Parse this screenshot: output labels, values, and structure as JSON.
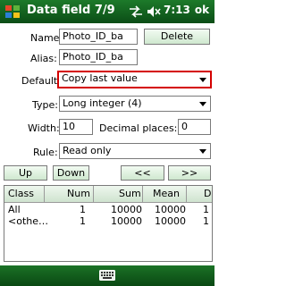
{
  "titlebar": {
    "title": "Data field 7/9",
    "time": "7:13",
    "ok_label": "ok"
  },
  "form": {
    "name_label": "Name:",
    "name_value": "Photo_ID_ba",
    "delete_label": "Delete",
    "alias_label": "Alias:",
    "alias_value": "Photo_ID_ba",
    "default_label": "Default:",
    "default_value": "Copy last value",
    "type_label": "Type:",
    "type_value": "Long integer (4)",
    "width_label": "Width:",
    "width_value": "10",
    "decimal_label": "Decimal places:",
    "decimal_value": "0",
    "rule_label": "Rule:",
    "rule_value": "Read only"
  },
  "nav": {
    "up_label": "Up",
    "down_label": "Down",
    "prev_label": "<<",
    "next_label": ">>"
  },
  "table": {
    "columns": [
      "Class",
      "Num",
      "Sum",
      "Mean",
      "D"
    ],
    "rows": [
      [
        "All",
        "1",
        "10000",
        "10000",
        "1"
      ],
      [
        "<othe…",
        "1",
        "10000",
        "10000",
        "1"
      ]
    ]
  },
  "icons": {
    "windows": "windows-logo-icon",
    "connectivity": "connectivity-arrows-icon",
    "volume": "volume-muted-icon",
    "keyboard": "keyboard-icon"
  },
  "colors": {
    "titlebar": "#0b4d16",
    "highlight_border": "#d40000"
  }
}
